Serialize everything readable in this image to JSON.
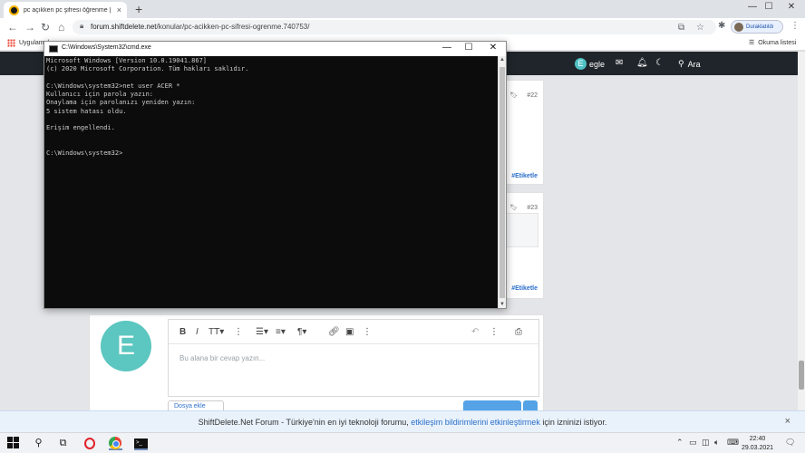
{
  "browser": {
    "tab_title": "pc açıkken pc şifresi öğrenme | S",
    "tab_close": "×",
    "new_tab": "+",
    "url_domain": "forum.shiftdelete.net",
    "url_path": "/konular/pc-acikken-pc-sifresi-ogrenme.740753/",
    "profile_label": "Duraklatıldı",
    "bookmarks_apps": "Uygulamalar",
    "reading_list": "Okuma listesi"
  },
  "site_header": {
    "user_initial": "E",
    "username": "egle",
    "search_label": "Ara"
  },
  "posts": [
    {
      "number": "#22",
      "tag": "#Etiketle"
    },
    {
      "number": "#23",
      "tag": "#Etiketle"
    }
  ],
  "reply": {
    "avatar_initial": "E",
    "placeholder": "Bu alana bir cevap yazın...",
    "attach_label": "Dosya ekle"
  },
  "notification": {
    "text_before": "ShiftDelete.Net Forum - Türkiye'nin en iyi teknoloji forumu,",
    "link_text": "etkileşim bildirimlerini etkinleştirmek",
    "text_after": "için izninizi istiyor.",
    "close": "×"
  },
  "cmd": {
    "title": "C:\\Windows\\System32\\cmd.exe",
    "lines": [
      "Microsoft Windows [Version 10.0.19041.867]",
      "(c) 2020 Microsoft Corporation. Tüm hakları saklıdır.",
      "",
      "C:\\Windows\\system32>net user ACER *",
      "Kullanıcı için parola yazın:",
      "Onaylama için parolanızı yeniden yazın:",
      "5 sistem hatası oldu.",
      "",
      "Erişim engellendi.",
      "",
      "",
      "C:\\Windows\\system32>"
    ]
  },
  "taskbar": {
    "time": "22:40",
    "date": "29.03.2021"
  }
}
